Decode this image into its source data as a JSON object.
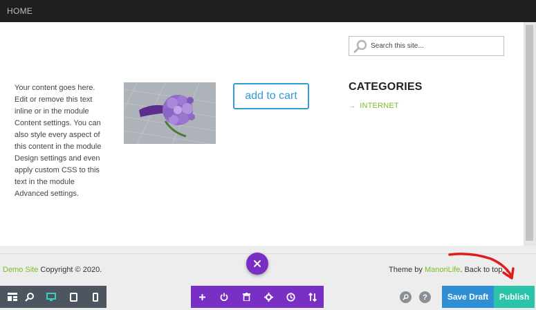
{
  "nav": {
    "home_label": "HOME"
  },
  "search": {
    "placeholder": "Search this site..."
  },
  "content": {
    "body_text": "Your content goes here. Edit or remove this text inline or in the module Content settings. You can also style every aspect of this content in the module Design settings and even apply custom CSS to this text in the module Advanced settings.",
    "add_to_cart_label": "add to cart"
  },
  "sidebar": {
    "categories_title": "CATEGORIES",
    "categories": [
      {
        "label": "INTERNET"
      }
    ]
  },
  "footer": {
    "site_link": "Demo Site",
    "copyright": " Copyright © 2020.",
    "theme_prefix": "Theme by ",
    "theme_link": "ManoriLife",
    "back_to_top": ". Back to top ↑"
  },
  "builder_toolbar": {
    "left_icons": [
      "wireframe-icon",
      "zoom-icon",
      "desktop-icon",
      "tablet-icon",
      "phone-icon"
    ],
    "mid_icons": [
      "plus-icon",
      "power-icon",
      "trash-icon",
      "gear-icon",
      "history-icon",
      "sort-icon"
    ],
    "help_label": "?",
    "save_draft_label": "Save Draft",
    "publish_label": "Publish"
  },
  "colors": {
    "accent_green": "#7cbb2b",
    "button_blue": "#2e9cd6",
    "toolbar_purple": "#7a2fc4",
    "publish_teal": "#29c4a9",
    "save_blue": "#2e8fd6",
    "annotation_red": "#e01b1b"
  }
}
